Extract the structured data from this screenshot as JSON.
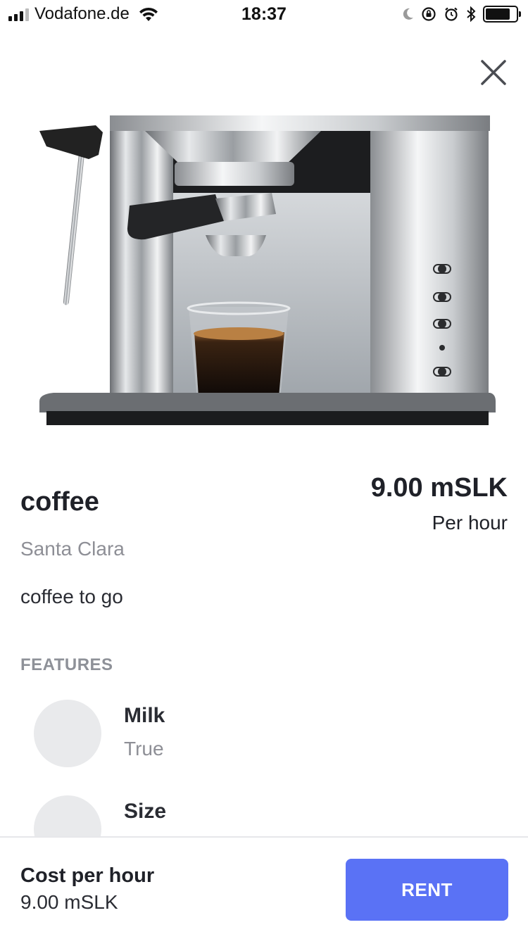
{
  "status_bar": {
    "carrier": "Vodafone.de",
    "time": "18:37",
    "icons": [
      "signal-icon",
      "wifi-icon",
      "moon-icon",
      "rotation-lock-icon",
      "alarm-icon",
      "bluetooth-icon",
      "battery-icon"
    ]
  },
  "close_icon": "close-icon",
  "product": {
    "image": "espresso-machine-photo",
    "title": "coffee",
    "price": "9.00 mSLK",
    "price_unit": "Per hour",
    "location": "Santa Clara",
    "description": "coffee to go"
  },
  "features": {
    "heading": "FEATURES",
    "items": [
      {
        "name": "Milk",
        "value": "True"
      },
      {
        "name": "Size",
        "value": ""
      }
    ]
  },
  "bottom_bar": {
    "cost_label": "Cost per hour",
    "cost_value": "9.00 mSLK",
    "rent_label": "RENT"
  },
  "colors": {
    "accent": "#5a72f5",
    "muted_text": "#8e8f96",
    "placeholder": "#e9eaec"
  }
}
